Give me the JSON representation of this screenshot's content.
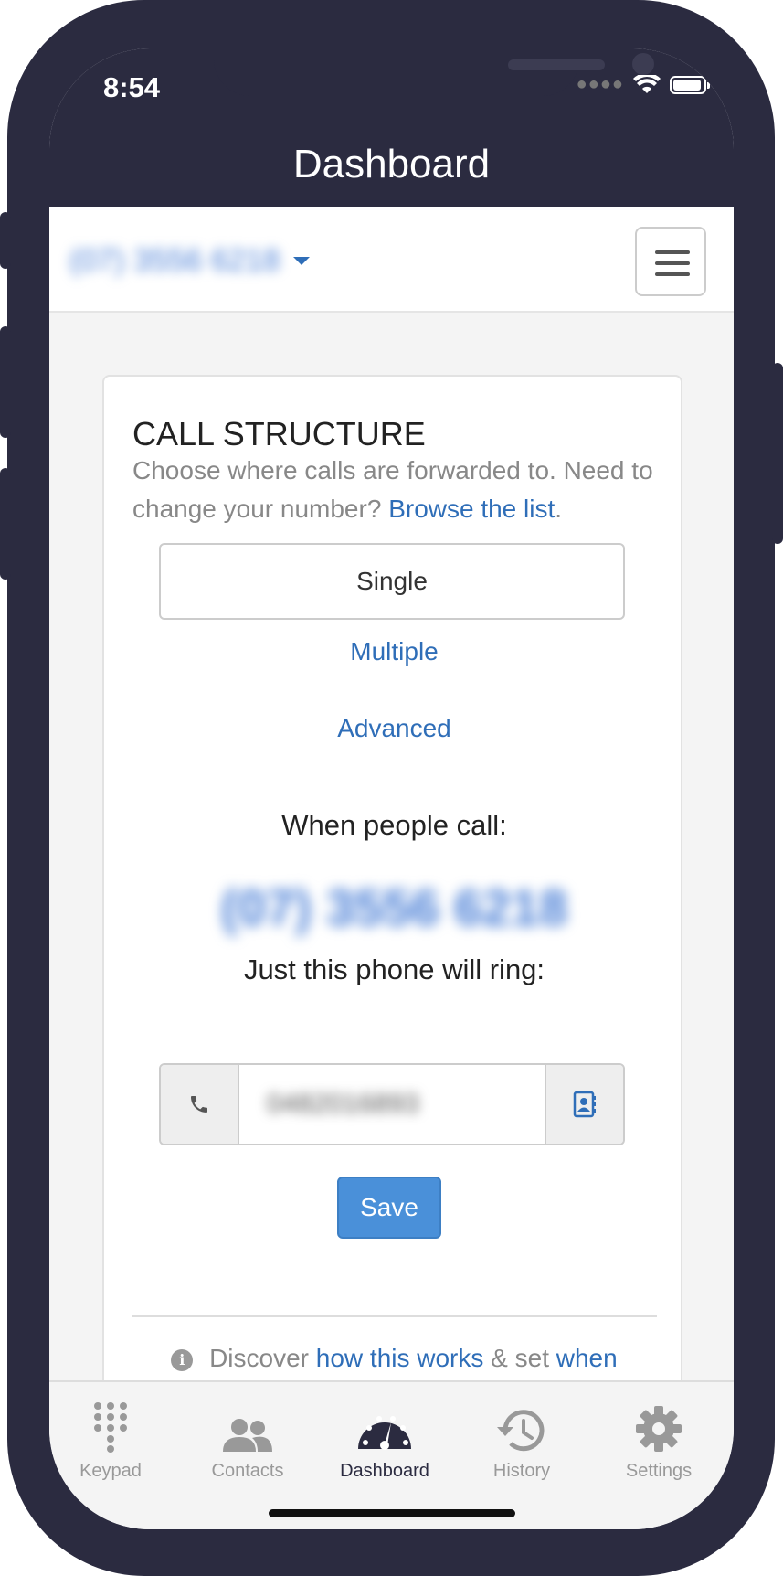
{
  "status_bar": {
    "time": "8:54"
  },
  "header": {
    "title": "Dashboard"
  },
  "account": {
    "number": "(07) 3556 6218"
  },
  "card": {
    "title": "CALL STRUCTURE",
    "description": "Choose where calls are forwarded to. Need to change your number?",
    "browse_link": "Browse the list",
    "browse_suffix": ".",
    "options": {
      "single": "Single",
      "multiple": "Multiple",
      "advanced": "Advanced"
    },
    "when_label": "When people call:",
    "tracking_number": "(07) 3556 6218",
    "ring_label": "Just this phone will ring:",
    "forward_number": "0482016893",
    "save_label": "Save",
    "info": {
      "prefix": "Discover",
      "how_link": "how this works",
      "middle": "& set",
      "when_link": "when"
    }
  },
  "tabbar": {
    "keypad": "Keypad",
    "contacts": "Contacts",
    "dashboard": "Dashboard",
    "history": "History",
    "settings": "Settings",
    "active": "dashboard"
  },
  "colors": {
    "frame": "#2b2b40",
    "link": "#2f6eb8",
    "primary_button": "#4a90d9"
  }
}
